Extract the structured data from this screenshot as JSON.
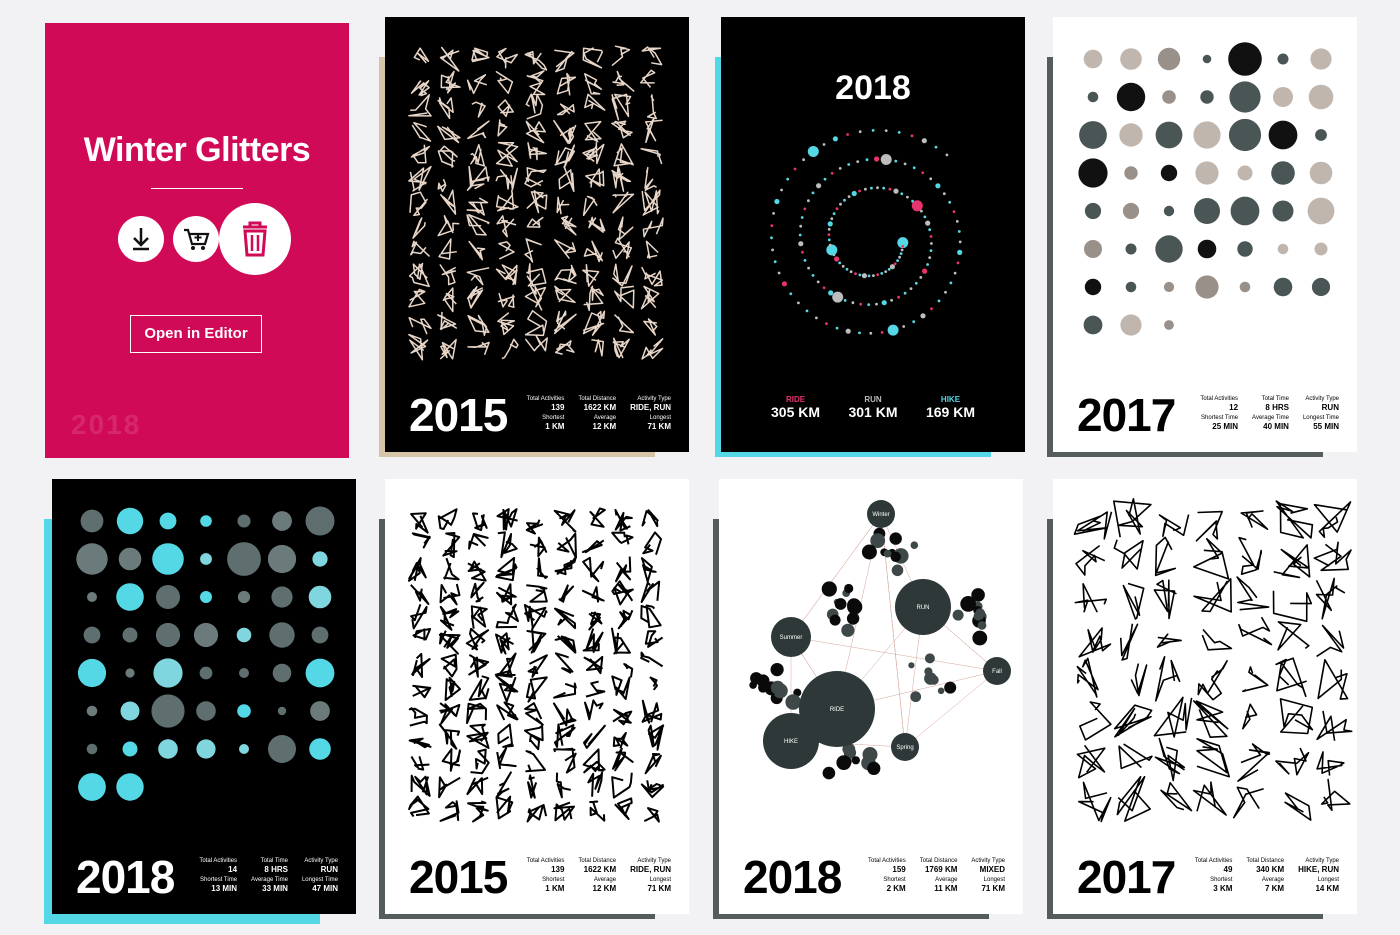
{
  "overlay": {
    "title": "Winter Glitters",
    "editor_label": "Open in Editor",
    "faded_year": "2018",
    "accent": "#d10a57",
    "icons": [
      "download-icon",
      "add-to-cart-icon",
      "trash-icon"
    ]
  },
  "cards": [
    {
      "id": "c2",
      "year": "2015",
      "theme": "dark",
      "shadow": "#d6c4a8",
      "stats": [
        [
          "Total Activities",
          "139"
        ],
        [
          "Total Distance",
          "1622 KM"
        ],
        [
          "Activity Type",
          "RIDE, RUN"
        ],
        [
          "Shortest",
          "1 KM"
        ],
        [
          "Average",
          "12 KM"
        ],
        [
          "Longest",
          "71 KM"
        ]
      ]
    },
    {
      "id": "c3",
      "year": "2018",
      "theme": "dark",
      "shadow": "#55d8e6",
      "legend": [
        {
          "label": "RIDE",
          "value": "305 KM",
          "color": "#e8346c"
        },
        {
          "label": "RUN",
          "value": "301 KM",
          "color": "#bdbdbd"
        },
        {
          "label": "HIKE",
          "value": "169 KM",
          "color": "#55d8e6"
        }
      ]
    },
    {
      "id": "c4",
      "year": "2017",
      "theme": "light",
      "shadow": "#555c5c",
      "stats": [
        [
          "Total Activities",
          "12"
        ],
        [
          "Total Time",
          "8 HRS"
        ],
        [
          "Activity Type",
          "RUN"
        ],
        [
          "Shortest Time",
          "25 MIN"
        ],
        [
          "Average Time",
          "40 MIN"
        ],
        [
          "Longest Time",
          "55 MIN"
        ]
      ]
    },
    {
      "id": "c5",
      "year": "2018",
      "theme": "dark",
      "shadow": "#55d8e6",
      "stats": [
        [
          "Total Activities",
          "14"
        ],
        [
          "Total Time",
          "8 HRS"
        ],
        [
          "Activity Type",
          "RUN"
        ],
        [
          "Shortest Time",
          "13 MIN"
        ],
        [
          "Average Time",
          "33 MIN"
        ],
        [
          "Longest Time",
          "47 MIN"
        ]
      ]
    },
    {
      "id": "c6",
      "year": "2015",
      "theme": "light",
      "shadow": "#555c5c",
      "stats": [
        [
          "Total Activities",
          "139"
        ],
        [
          "Total Distance",
          "1622 KM"
        ],
        [
          "Activity Type",
          "RIDE, RUN"
        ],
        [
          "Shortest",
          "1 KM"
        ],
        [
          "Average",
          "12 KM"
        ],
        [
          "Longest",
          "71 KM"
        ]
      ]
    },
    {
      "id": "c7",
      "year": "2018",
      "theme": "light",
      "shadow": "#555c5c",
      "nodes": [
        "Winter",
        "RUN",
        "Summer",
        "Fall",
        "RIDE",
        "HIKE",
        "Spring"
      ],
      "stats": [
        [
          "Total Activities",
          "159"
        ],
        [
          "Total Distance",
          "1769 KM"
        ],
        [
          "Activity Type",
          "MIXED"
        ],
        [
          "Shortest",
          "2 KM"
        ],
        [
          "Average",
          "11 KM"
        ],
        [
          "Longest",
          "71 KM"
        ]
      ]
    },
    {
      "id": "c8",
      "year": "2017",
      "theme": "light",
      "shadow": "#555c5c",
      "stats": [
        [
          "Total Activities",
          "49"
        ],
        [
          "Total Distance",
          "340 KM"
        ],
        [
          "Activity Type",
          "HIKE, RUN"
        ],
        [
          "Shortest",
          "3 KM"
        ],
        [
          "Average",
          "7 KM"
        ],
        [
          "Longest",
          "14 KM"
        ]
      ]
    }
  ]
}
